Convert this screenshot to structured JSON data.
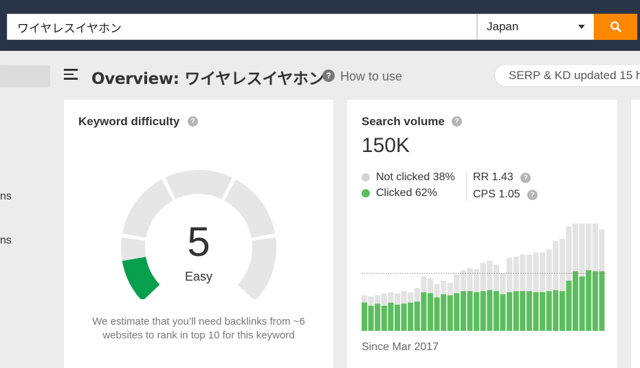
{
  "search": {
    "query": "ワイヤレスイヤホン",
    "country": "Japan"
  },
  "sidebar": {
    "item_1_fragment": "ns",
    "item_2_fragment": "ns"
  },
  "header": {
    "title": "Overview: ワイヤレスイヤホン",
    "how_to_use": "How to use",
    "serp_status": "SERP & KD updated 15 h"
  },
  "keyword_difficulty": {
    "title": "Keyword difficulty",
    "score": 5,
    "score_text": "5",
    "label": "Easy",
    "note": "We estimate that you’ll need backlinks from ~6 websites to rank in top 10 for this keyword",
    "gauge_max": 100,
    "colors": {
      "filled": "#089f4e",
      "track": "#e6e6e6"
    }
  },
  "search_volume": {
    "title": "Search volume",
    "value": "150K",
    "not_clicked_label": "Not clicked 38%",
    "clicked_label": "Clicked 62%",
    "rr": "RR 1.43",
    "cps": "CPS 1.05",
    "since": "Since Mar 2017",
    "colors": {
      "clicked": "#5cbd5e",
      "not_clicked": "#e3e3e3",
      "not_clicked_dot": "#d3d3d3"
    }
  },
  "colors": {
    "topbar": "#2a3447",
    "accent": "#ff8800"
  },
  "chart_data": {
    "type": "bar",
    "series": [
      {
        "name": "Clicked",
        "values": [
          27,
          24,
          26,
          24,
          27,
          25,
          26,
          27,
          28,
          37,
          36,
          32,
          35,
          34,
          36,
          38,
          38,
          37,
          38,
          39,
          38,
          35,
          37,
          38,
          38,
          38,
          37,
          37,
          38,
          39,
          38,
          48,
          57,
          52,
          58,
          57,
          57
        ]
      },
      {
        "name": "Not clicked",
        "values": [
          7,
          9,
          8,
          12,
          10,
          11,
          12,
          10,
          13,
          15,
          14,
          13,
          13,
          12,
          18,
          20,
          22,
          22,
          27,
          28,
          25,
          20,
          33,
          33,
          35,
          35,
          38,
          38,
          40,
          47,
          50,
          52,
          47,
          52,
          50,
          50,
          40
        ]
      }
    ],
    "reference_line": 55,
    "ylim": [
      0,
      100
    ]
  }
}
